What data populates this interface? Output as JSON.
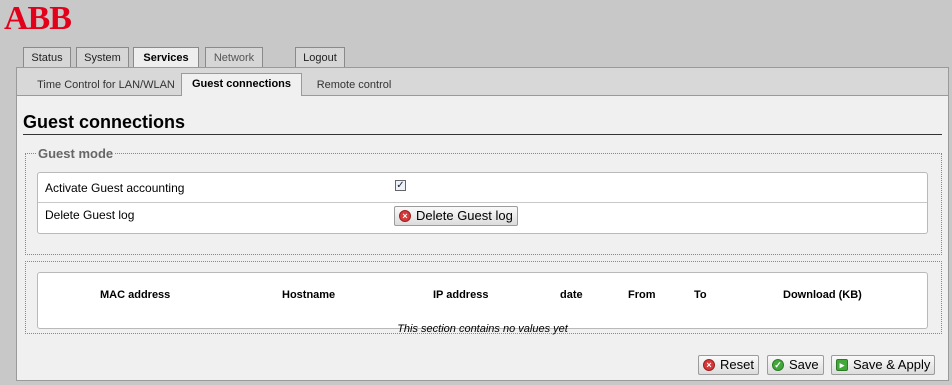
{
  "brand": {
    "logo_text": "ABB",
    "color": "#e2001a"
  },
  "main_tabs": [
    {
      "label": "Status",
      "state": "normal"
    },
    {
      "label": "System",
      "state": "normal"
    },
    {
      "label": "Services",
      "state": "active"
    },
    {
      "label": "Network",
      "state": "disabled"
    },
    {
      "label": "Logout",
      "state": "normal"
    }
  ],
  "sub_tabs": [
    {
      "label": "Time Control for LAN/WLAN",
      "state": "normal"
    },
    {
      "label": "Guest connections",
      "state": "active"
    },
    {
      "label": "Remote control",
      "state": "normal"
    }
  ],
  "page": {
    "title": "Guest connections",
    "guest_mode": {
      "legend": "Guest mode",
      "activate_label": "Activate Guest accounting",
      "activate_checked": true,
      "delete_label": "Delete Guest log",
      "delete_button": "Delete Guest log"
    },
    "log_table": {
      "columns": [
        "MAC address",
        "Hostname",
        "IP address",
        "date",
        "From",
        "To",
        "Download (KB)"
      ],
      "rows": [],
      "empty_message": "This section contains no values yet"
    }
  },
  "actions": {
    "reset": "Reset",
    "save": "Save",
    "save_apply": "Save & Apply"
  },
  "icons": {
    "delete": "red-x-circle-icon",
    "reset": "red-x-circle-icon",
    "save": "green-check-circle-icon",
    "save_apply": "green-arrow-square-icon"
  }
}
